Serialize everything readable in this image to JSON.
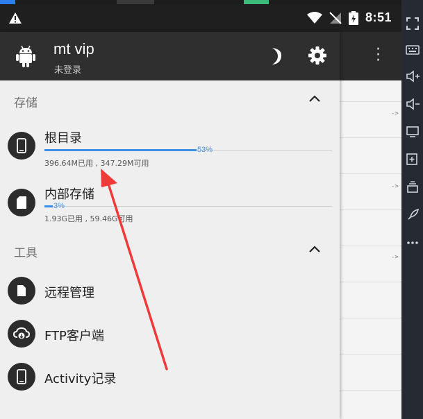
{
  "status_bar": {
    "time": "8:51"
  },
  "drawer": {
    "app_name": "mt vip",
    "login_status": "未登录",
    "sections": [
      {
        "title": "存储",
        "items": [
          {
            "label": "根目录",
            "usage_percent": 53,
            "percent_text": "53%",
            "usage_text": "396.64M已用 , 347.29M可用",
            "icon": "phone-icon"
          },
          {
            "label": "内部存储",
            "usage_percent": 3,
            "percent_text": "3%",
            "usage_text": "1.93G已用 , 59.46G可用",
            "icon": "sd-card-icon"
          }
        ]
      },
      {
        "title": "工具",
        "items": [
          {
            "label": "远程管理",
            "icon": "file-icon"
          },
          {
            "label": "FTP客户端",
            "icon": "cloud-icon"
          },
          {
            "label": "Activity记录",
            "icon": "phone-icon"
          }
        ]
      }
    ]
  },
  "background_app": {
    "arrow_text": "->"
  },
  "colors": {
    "accent": "#3d8fe6",
    "drawer_header": "#2f2f2f",
    "drawer_bg": "#efefef",
    "annotation_arrow": "#f03a3a"
  }
}
